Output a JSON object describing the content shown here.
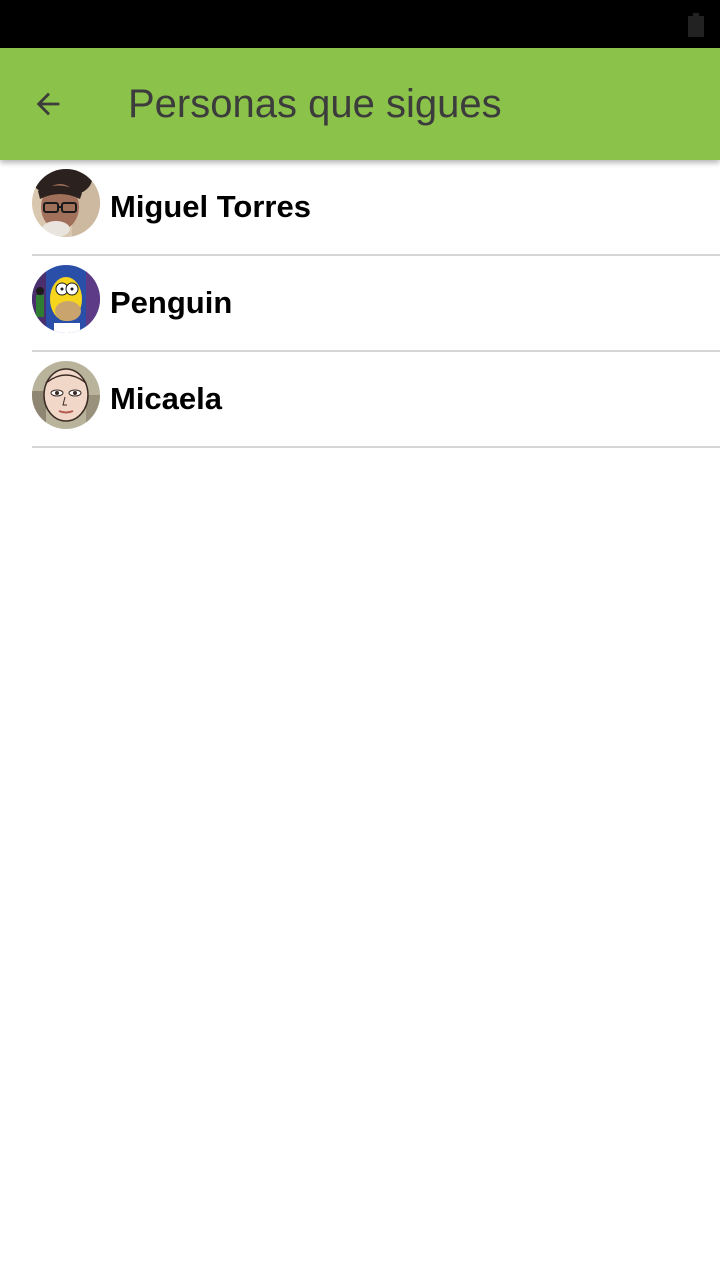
{
  "colors": {
    "app_bar": "#8bc34a",
    "title_text": "#3c3c3c",
    "status_bar": "#000000",
    "divider": "#d6d6d6"
  },
  "header": {
    "back_icon": "arrow-left-icon",
    "title": "Personas que sigues"
  },
  "following": [
    {
      "name": "Miguel Torres",
      "avatar": "user-photo-avatar"
    },
    {
      "name": "Penguin",
      "avatar": "cartoon-character-avatar"
    },
    {
      "name": "Micaela",
      "avatar": "drawn-face-avatar"
    }
  ]
}
